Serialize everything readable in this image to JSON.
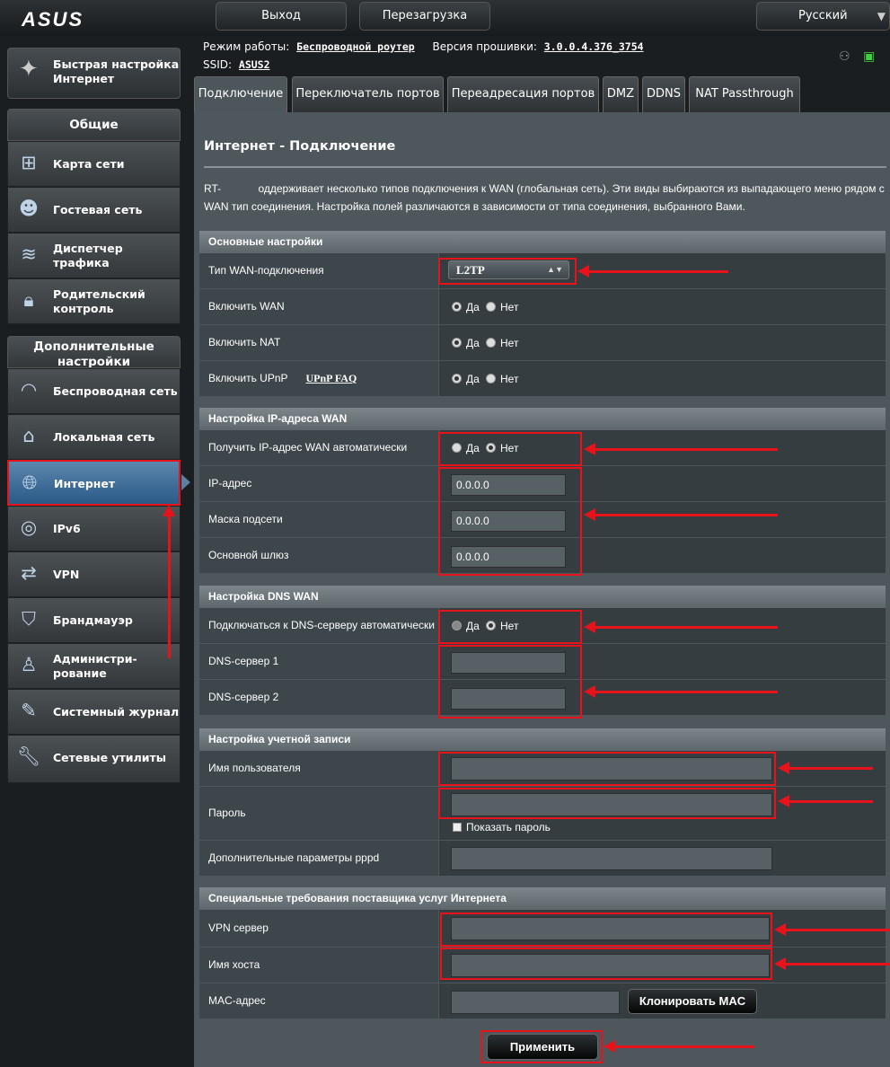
{
  "header": {
    "logo": "ASUS",
    "logout_label": "Выход",
    "reboot_label": "Перезагрузка",
    "language": "Русский"
  },
  "info": {
    "mode_label": "Режим работы:",
    "mode_value": "Беспроводной роутер",
    "firmware_label": "Версия прошивки:",
    "firmware_value": "3.0.0.4.376_3754",
    "ssid_label": "SSID:",
    "ssid_value": "ASUS2"
  },
  "sidebar": {
    "quick_setup": "Быстрая настройка Интернет",
    "general_header": "Общие",
    "general_items": [
      {
        "label": "Карта сети",
        "icon": "network-map-icon"
      },
      {
        "label": "Гостевая сеть",
        "icon": "guest-network-icon"
      },
      {
        "label": "Диспетчер трафика",
        "icon": "traffic-manager-icon"
      },
      {
        "label": "Родительский контроль",
        "icon": "parental-control-icon"
      }
    ],
    "advanced_header": "Дополнительные настройки",
    "advanced_items": [
      {
        "label": "Беспроводная сеть",
        "icon": "wireless-icon"
      },
      {
        "label": "Локальная сеть",
        "icon": "lan-icon"
      },
      {
        "label": "Интернет",
        "icon": "internet-icon",
        "active": true
      },
      {
        "label": "IPv6",
        "icon": "ipv6-icon"
      },
      {
        "label": "VPN",
        "icon": "vpn-icon"
      },
      {
        "label": "Брандмауэр",
        "icon": "firewall-icon"
      },
      {
        "label": "Администри-рование",
        "icon": "administration-icon"
      },
      {
        "label": "Системный журнал",
        "icon": "system-log-icon"
      },
      {
        "label": "Сетевые утилиты",
        "icon": "network-tools-icon"
      }
    ]
  },
  "tabs": [
    "Подключение",
    "Переключатель портов",
    "Переадресация портов",
    "DMZ",
    "DDNS",
    "NAT Passthrough"
  ],
  "page": {
    "title": "Интернет - Подключение",
    "description_prefix": "RT-",
    "description": "оддерживает несколько типов подключения к WAN (глобальная сеть). Эти виды выбираются из выпадающего меню рядом с WAN тип соединения. Настройка полей различаются в зависимости от типа соединения, выбранного Вами."
  },
  "radio": {
    "yes": "Да",
    "no": "Нет"
  },
  "basic": {
    "header": "Основные настройки",
    "wan_type_label": "Тип WAN-подключения",
    "wan_type_value": "L2TP",
    "enable_wan_label": "Включить WAN",
    "enable_nat_label": "Включить NAT",
    "enable_upnp_label": "Включить UPnP",
    "upnp_faq": "UPnP FAQ"
  },
  "wan_ip": {
    "header": "Настройка IP-адреса WAN",
    "auto_label": "Получить IP-адрес WAN автоматически",
    "ip_label": "IP-адрес",
    "ip_value": "0.0.0.0",
    "mask_label": "Маска подсети",
    "mask_value": "0.0.0.0",
    "gateway_label": "Основной шлюз",
    "gateway_value": "0.0.0.0"
  },
  "dns": {
    "header": "Настройка DNS WAN",
    "auto_label": "Подключаться к DNS-серверу автоматически",
    "dns1_label": "DNS-сервер 1",
    "dns2_label": "DNS-сервер 2"
  },
  "account": {
    "header": "Настройка учетной записи",
    "username_label": "Имя пользователя",
    "password_label": "Пароль",
    "show_password": "Показать пароль",
    "pppd_label": "Дополнительные параметры pppd"
  },
  "isp": {
    "header": "Специальные требования поставщика услуг Интернета",
    "vpn_label": "VPN сервер",
    "host_label": "Имя хоста",
    "mac_label": "MAC-адрес",
    "clone_mac": "Клонировать MAC"
  },
  "apply_label": "Применить",
  "colors": {
    "annotation_red": "#e8131a",
    "active_menu": "#3a6c9a"
  }
}
